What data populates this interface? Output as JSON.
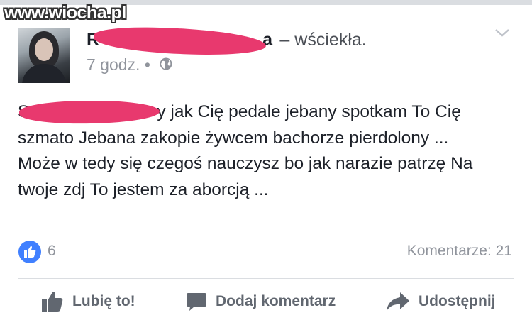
{
  "watermark": "www.wiocha.pl",
  "post": {
    "author_visible": "R",
    "author_tail": "a",
    "feeling": "– wściekła.",
    "time": "7 godz.",
    "separator": "•",
    "lines": [
      "S",
      "y jak Cię pedale jebany spotkam To Cię szmato Jebana zakopie żywcem bachorze pierdolony ...",
      "Może w tedy się czegoś nauczysz bo jak narazie patrzę Na twoje zdj To jestem za aborcją ..."
    ]
  },
  "stats": {
    "likes": "6",
    "comments": "Komentarze: 21"
  },
  "actions": {
    "like": "Lubię to!",
    "comment": "Dodaj komentarz",
    "share": "Udostępnij"
  },
  "colors": {
    "redaction": "#e8396e",
    "like_blue": "#4080ff",
    "muted": "#90949c",
    "action_gray": "#616770"
  },
  "icons": [
    "globe-icon",
    "chevron-down-icon",
    "like-reaction-icon",
    "thumbs-up-icon",
    "comment-icon",
    "share-icon"
  ]
}
